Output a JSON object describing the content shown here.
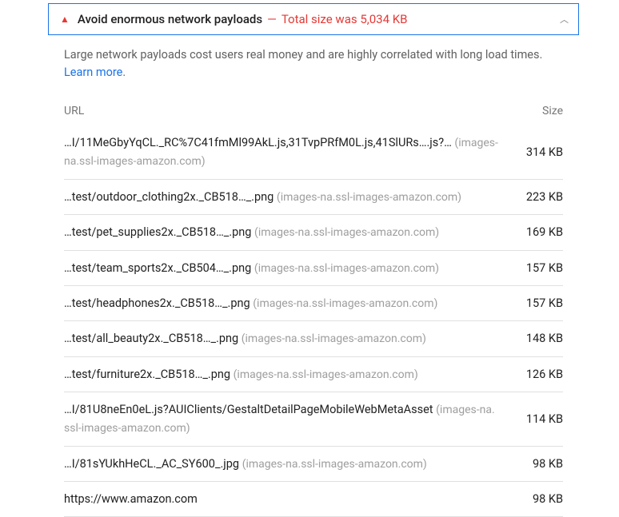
{
  "header": {
    "title": "Avoid enormous network payloads",
    "separator": "—",
    "total": "Total size was 5,034 KB"
  },
  "description": {
    "text": "Large network payloads cost users real money and are highly correlated with long load times.",
    "learn": "Learn more"
  },
  "table": {
    "col_url": "URL",
    "col_size": "Size",
    "rows": [
      {
        "url": "…I/11MeGbyYqCL._RC%7C41fmMl99AkL.js,31TvpPRfM0L.js,41SlURs….js?…",
        "domain": "(images-na.ssl-images-amazon.com)",
        "size": "314 KB"
      },
      {
        "url": "…test/outdoor_clothing2x._CB518…_.png",
        "domain": "(images-na.ssl-images-amazon.com)",
        "size": "223 KB"
      },
      {
        "url": "…test/pet_supplies2x._CB518…_.png",
        "domain": "(images-na.ssl-images-amazon.com)",
        "size": "169 KB"
      },
      {
        "url": "…test/team_sports2x._CB504…_.png",
        "domain": "(images-na.ssl-images-amazon.com)",
        "size": "157 KB"
      },
      {
        "url": "…test/headphones2x._CB518…_.png",
        "domain": "(images-na.ssl-images-amazon.com)",
        "size": "157 KB"
      },
      {
        "url": "…test/all_beauty2x._CB518…_.png",
        "domain": "(images-na.ssl-images-amazon.com)",
        "size": "148 KB"
      },
      {
        "url": "…test/furniture2x._CB518…_.png",
        "domain": "(images-na.ssl-images-amazon.com)",
        "size": "126 KB"
      },
      {
        "url": "…I/81U8neEn0eL.js?AUIClients/GestaltDetailPageMobileWebMetaAsset",
        "domain": "(images-na.ssl-images-amazon.com)",
        "size": "114 KB"
      },
      {
        "url": "…I/81sYUkhHeCL._AC_SY600_.jpg",
        "domain": "(images-na.ssl-images-amazon.com)",
        "size": "98 KB"
      },
      {
        "url": "https://www.amazon.com",
        "domain": "",
        "size": "98 KB"
      }
    ]
  }
}
